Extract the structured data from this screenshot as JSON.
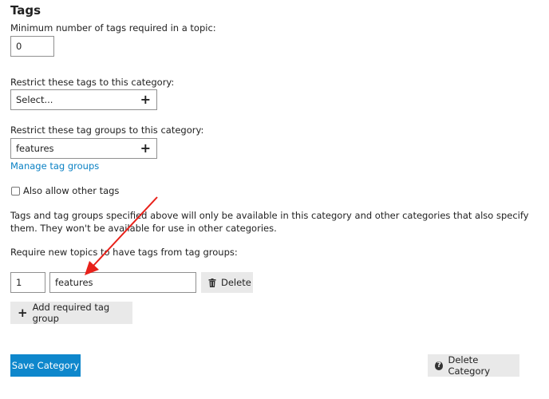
{
  "section_title": "Tags",
  "min_tags": {
    "label": "Minimum number of tags required in a topic:",
    "value": "0"
  },
  "restrict_tags": {
    "label": "Restrict these tags to this category:",
    "placeholder": "Select...",
    "plus_icon": "plus-icon"
  },
  "restrict_tag_groups": {
    "label": "Restrict these tag groups to this category:",
    "value": "features",
    "plus_icon": "plus-icon",
    "manage_link": "Manage tag groups"
  },
  "allow_other_tags": {
    "label": "Also allow other tags",
    "checked": false
  },
  "help_text": "Tags and tag groups specified above will only be available in this category and other categories that also specify them. They won't be available for use in other categories.",
  "required_groups": {
    "label": "Require new topics to have tags from tag groups:",
    "rows": [
      {
        "count": "1",
        "group": "features",
        "delete_label": "Delete",
        "delete_icon": "trash-icon"
      }
    ],
    "add_label": "Add required tag group",
    "add_icon": "plus-icon"
  },
  "footer": {
    "save_label": "Save Category",
    "delete_label": "Delete Category",
    "delete_icon": "question-circle-icon"
  },
  "colors": {
    "accent": "#0e87cc",
    "link": "#0a81c4",
    "annotation_arrow": "#e8211a",
    "button_grey": "#e9e9e9"
  }
}
